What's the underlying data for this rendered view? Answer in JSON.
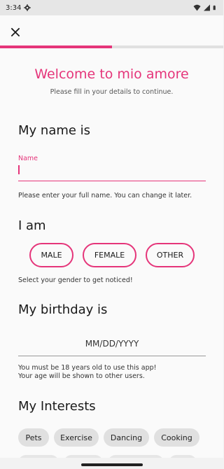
{
  "status_bar": {
    "time": "3:34",
    "icons": [
      "gear-icon",
      "wifi-icon",
      "signal-icon",
      "battery-icon"
    ]
  },
  "header": {
    "close_icon": "close-icon",
    "progress": 0.5
  },
  "welcome": {
    "title": "Welcome to mio amore",
    "subtitle": "Please fill in your details to continue."
  },
  "name_section": {
    "title": "My name is",
    "field_label": "Name",
    "value": "",
    "helper": "Please enter your full name. You can change it later."
  },
  "gender_section": {
    "title": "I am",
    "options": [
      "MALE",
      "FEMALE",
      "OTHER"
    ],
    "helper": "Select your gender to get noticed!"
  },
  "birthday_section": {
    "title": "My birthday is",
    "placeholder": "MM/DD/YYYY",
    "helper_line1": "You must be 18 years old to use this app!",
    "helper_line2": "Your age will be shown to other users."
  },
  "interests_section": {
    "title": "My Interests",
    "chips": [
      "Pets",
      "Exercise",
      "Dancing",
      "Cooking"
    ]
  },
  "colors": {
    "accent": "#e5357a",
    "chip_bg": "#e0e0e0",
    "background": "#fafafa"
  }
}
